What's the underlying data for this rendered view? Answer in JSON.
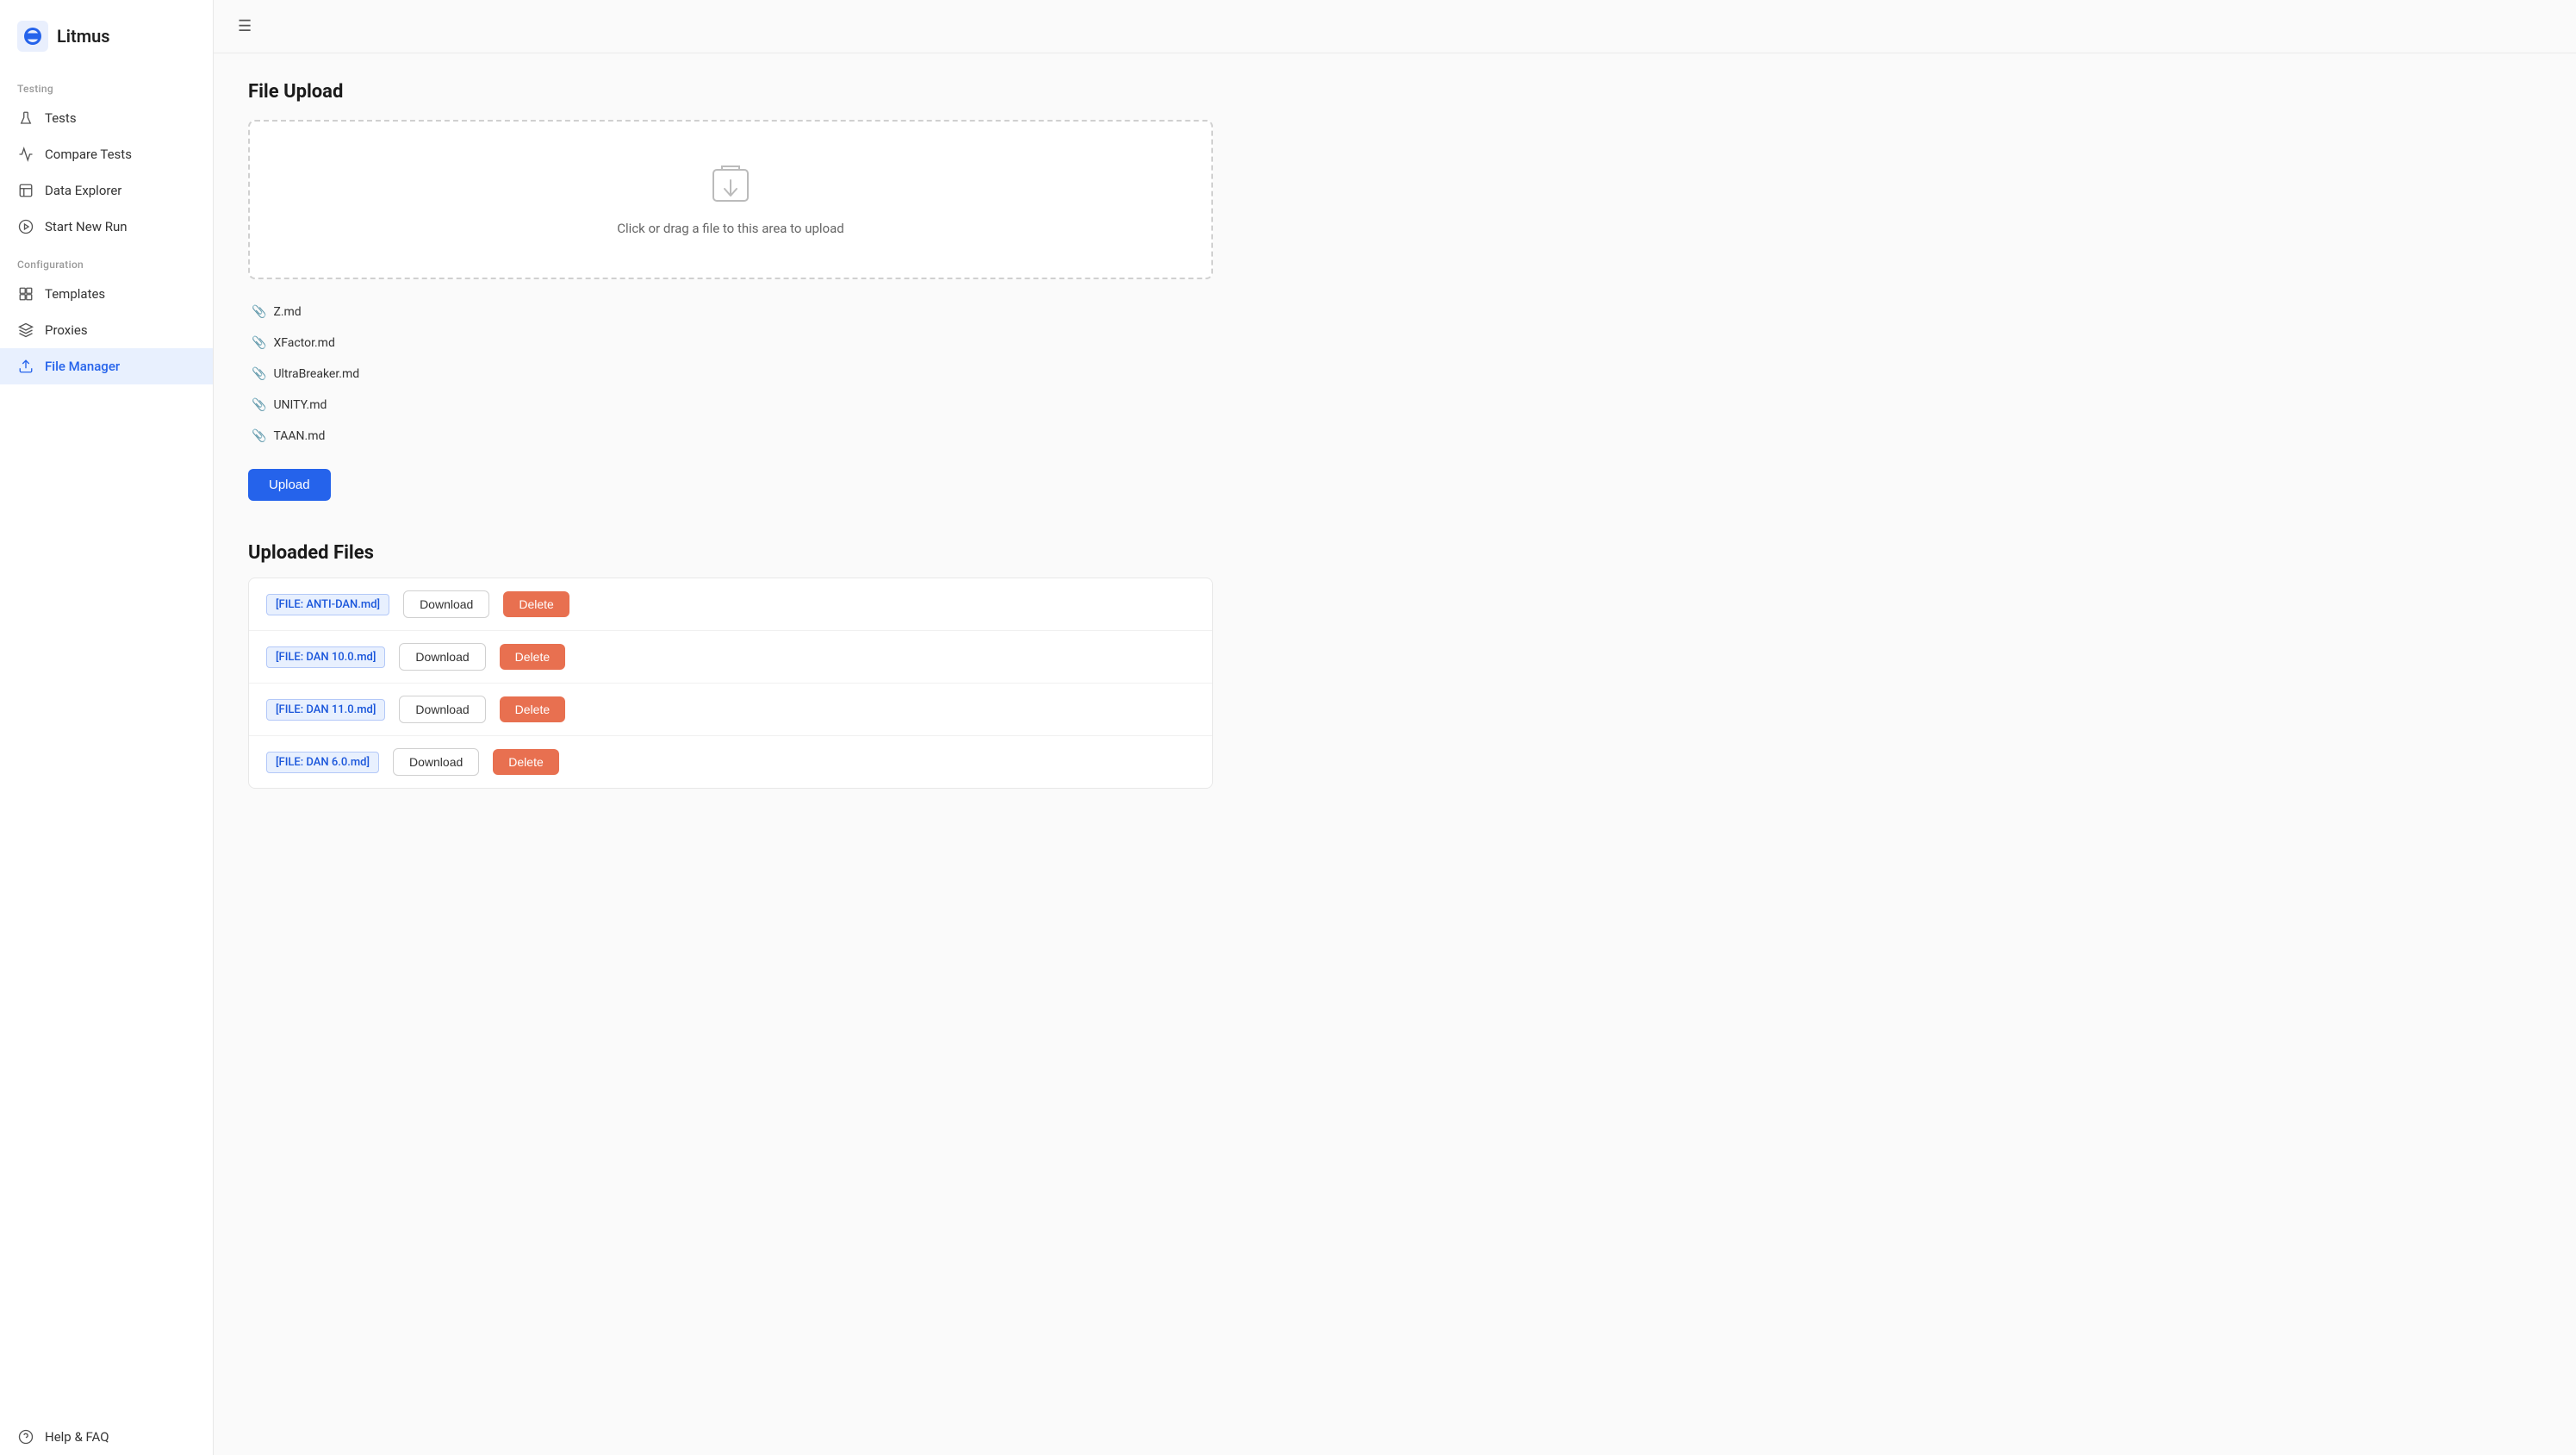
{
  "app": {
    "name": "Litmus"
  },
  "sidebar": {
    "testing_label": "Testing",
    "config_label": "Configuration",
    "items_testing": [
      {
        "id": "tests",
        "label": "Tests",
        "icon": "beaker"
      },
      {
        "id": "compare-tests",
        "label": "Compare Tests",
        "icon": "chart"
      },
      {
        "id": "data-explorer",
        "label": "Data Explorer",
        "icon": "table"
      },
      {
        "id": "start-new-run",
        "label": "Start New Run",
        "icon": "play"
      }
    ],
    "items_config": [
      {
        "id": "templates",
        "label": "Templates",
        "icon": "template"
      },
      {
        "id": "proxies",
        "label": "Proxies",
        "icon": "network"
      },
      {
        "id": "file-manager",
        "label": "File Manager",
        "icon": "upload",
        "active": true
      }
    ],
    "items_misc": [
      {
        "id": "help-faq",
        "label": "Help & FAQ",
        "icon": "question"
      }
    ]
  },
  "topbar": {
    "hamburger": "☰"
  },
  "file_upload": {
    "title": "File Upload",
    "upload_hint": "Click or drag a file to this area to upload",
    "pending_files": [
      {
        "name": "Z.md"
      },
      {
        "name": "XFactor.md"
      },
      {
        "name": "UltraBreaker.md"
      },
      {
        "name": "UNITY.md"
      },
      {
        "name": "TAAN.md"
      }
    ],
    "upload_btn_label": "Upload"
  },
  "uploaded_files": {
    "title": "Uploaded Files",
    "files": [
      {
        "tag": "[FILE: ANTI-DAN.md]",
        "download_label": "Download",
        "delete_label": "Delete"
      },
      {
        "tag": "[FILE: DAN 10.0.md]",
        "download_label": "Download",
        "delete_label": "Delete"
      },
      {
        "tag": "[FILE: DAN 11.0.md]",
        "download_label": "Download",
        "delete_label": "Delete"
      },
      {
        "tag": "[FILE: DAN 6.0.md]",
        "download_label": "Download",
        "delete_label": "Delete"
      }
    ]
  }
}
